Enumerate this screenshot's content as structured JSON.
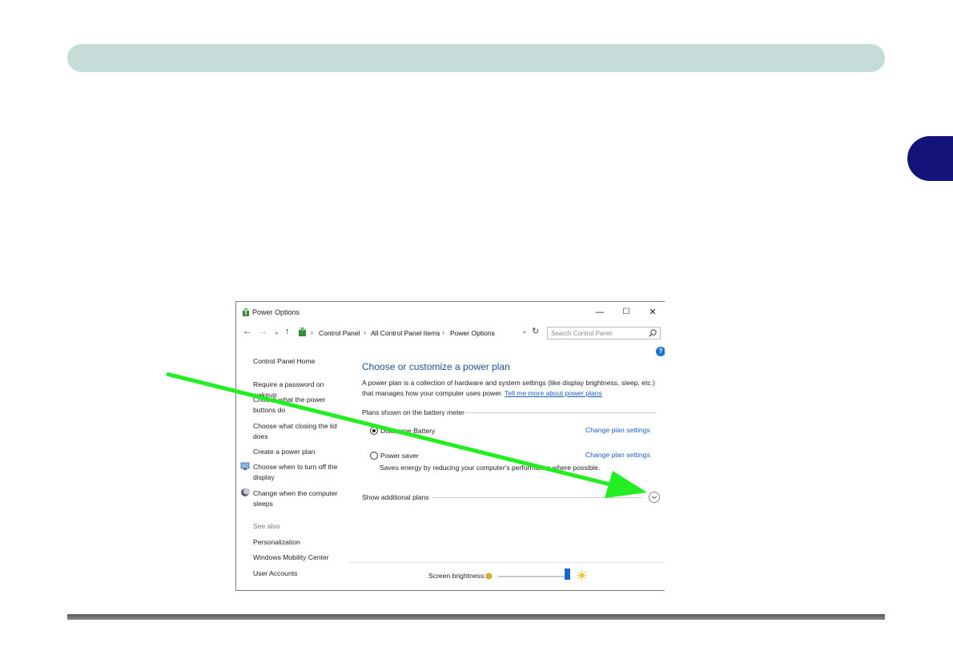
{
  "window": {
    "title": "Power Options",
    "controls": {
      "minimize": "—",
      "maximize": "☐",
      "close": "✕"
    }
  },
  "address": {
    "breadcrumbs": [
      "Control Panel",
      "All Control Panel Items",
      "Power Options"
    ],
    "search_placeholder": "Search Control Panel"
  },
  "sidebar": {
    "home": "Control Panel Home",
    "links": [
      "Require a password on wakeup",
      "Choose what the power buttons do",
      "Choose what closing the lid does",
      "Create a power plan",
      "Choose when to turn off the display",
      "Change when the computer sleeps"
    ],
    "see_also_label": "See also",
    "see_also": [
      "Personalization",
      "Windows Mobility Center",
      "User Accounts"
    ]
  },
  "main": {
    "help": "?",
    "title": "Choose or customize a power plan",
    "description": "A power plan is a collection of hardware and system settings (like display brightness, sleep, etc.) that manages how your computer uses power.",
    "learn_more_link": "Tell me more about power plans",
    "plans_group_label": "Plans shown on the battery meter",
    "plans": [
      {
        "name": "Discharge Battery",
        "selected": true,
        "link": "Change plan settings"
      },
      {
        "name": "Power saver",
        "selected": false,
        "link": "Change plan settings",
        "description": "Saves energy by reducing your computer's performance where possible."
      }
    ],
    "show_additional": "Show additional plans",
    "brightness_label": "Screen brightness:",
    "brightness_level": 0.95
  },
  "colors": {
    "header_bar": "#c6dcd8",
    "chapter_tab": "#13137a",
    "arrow": "#22ee22",
    "link": "#1a5fbf",
    "title": "#1e4f91"
  }
}
